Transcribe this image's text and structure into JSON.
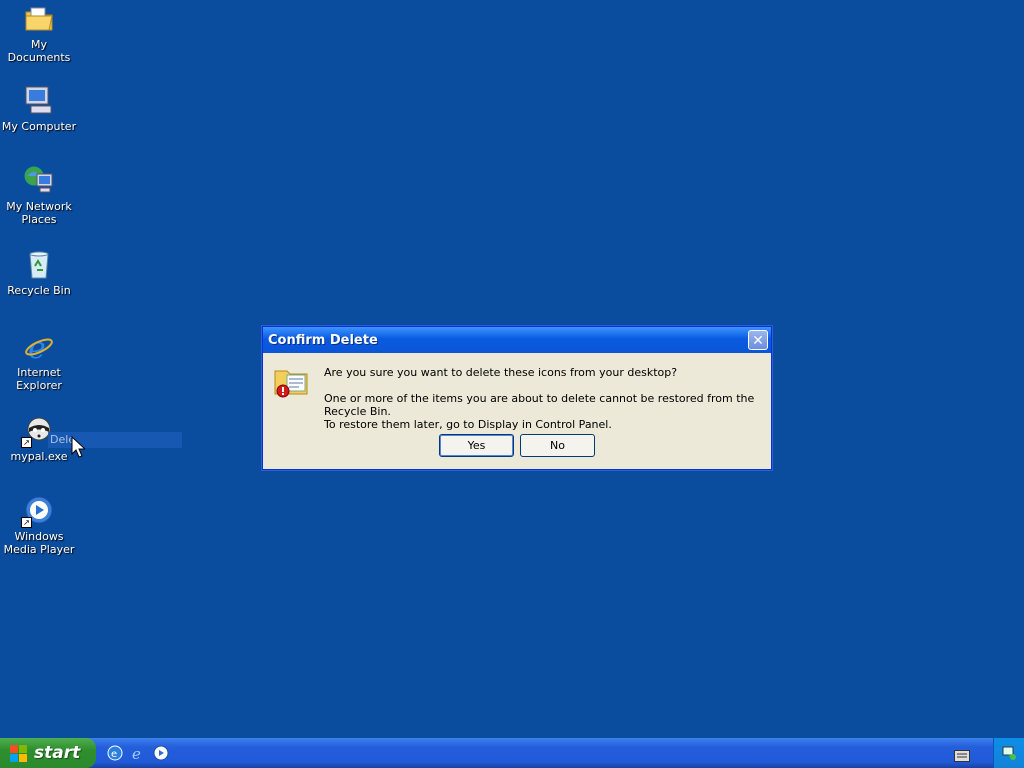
{
  "desktop": {
    "icons": [
      {
        "label": "My Documents"
      },
      {
        "label": "My Computer"
      },
      {
        "label": "My Network Places"
      },
      {
        "label": "Recycle Bin"
      },
      {
        "label": "Internet Explorer"
      },
      {
        "label": "mypal.exe"
      },
      {
        "label": "Windows Media Player"
      }
    ],
    "rename_text": "Dele"
  },
  "dialog": {
    "title": "Confirm Delete",
    "question": "Are you sure you want to delete these icons from your desktop?",
    "detail_line1": "One or more of the items you are about to delete cannot be restored from the Recycle Bin.",
    "detail_line2": "To restore them later, go to Display in Control Panel.",
    "yes_label": "Yes",
    "no_label": "No"
  },
  "taskbar": {
    "start_label": "start"
  }
}
